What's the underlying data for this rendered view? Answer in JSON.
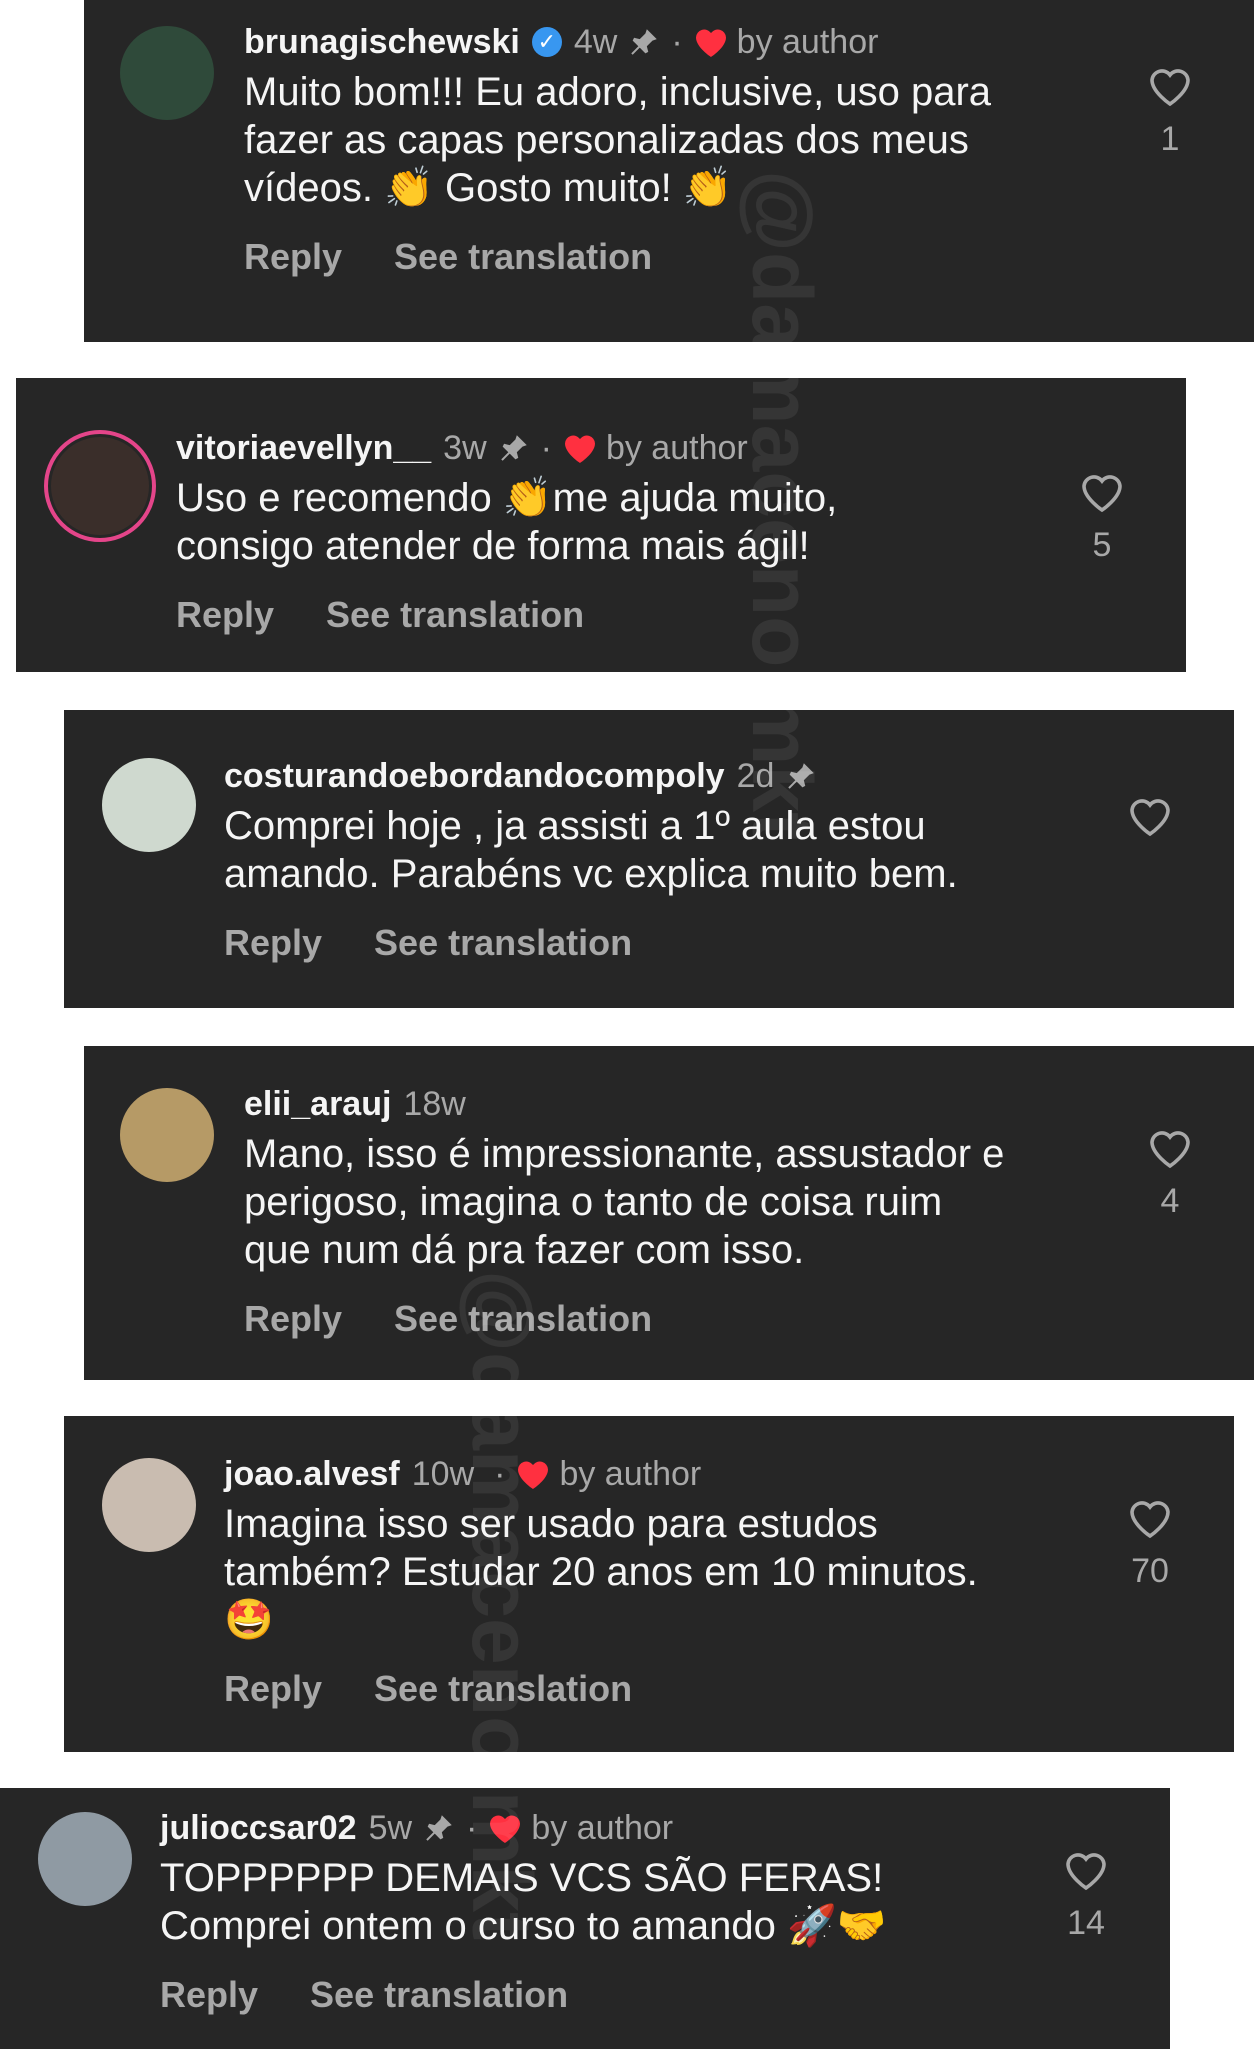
{
  "watermark": "@damaceno.mkt",
  "actions": {
    "reply": "Reply",
    "translate": "See translation"
  },
  "comments": [
    {
      "username": "brunagischewski",
      "time": "4w",
      "by_author": "by author",
      "text": "Muito bom!!! Eu adoro, inclusive, uso para\nfazer as capas personalizadas dos meus\nvídeos. 👏 Gosto muito! 👏",
      "likes": "1"
    },
    {
      "username": "vitoriaevellyn__",
      "time": "3w",
      "by_author": "by author",
      "text": "Uso e recomendo 👏me ajuda muito,\nconsigo atender de forma mais ágil!",
      "likes": "5"
    },
    {
      "username": "costurandoebordandocompoly",
      "time": "2d",
      "text": "Comprei hoje , ja assisti a 1º aula estou\namando. Parabéns vc explica muito bem.",
      "likes": ""
    },
    {
      "username": "elii_arauj",
      "time": "18w",
      "text": "Mano, isso é impressionante,  assustador e\nperigoso, imagina o tanto de coisa ruim\nque num dá pra fazer com isso.",
      "likes": "4"
    },
    {
      "username": "joao.alvesf",
      "time": "10w",
      "by_author": "by author",
      "text": "Imagina isso ser usado para estudos\ntambém? Estudar 20 anos em 10 minutos.\n🤩",
      "likes": "70"
    },
    {
      "username": "julioccsar02",
      "time": "5w",
      "by_author": "by author",
      "text": "TOPPPPPP DEMAIS VCS SÃO FERAS!\nComprei ontem o curso to amando 🚀🤝",
      "likes": "14"
    }
  ]
}
